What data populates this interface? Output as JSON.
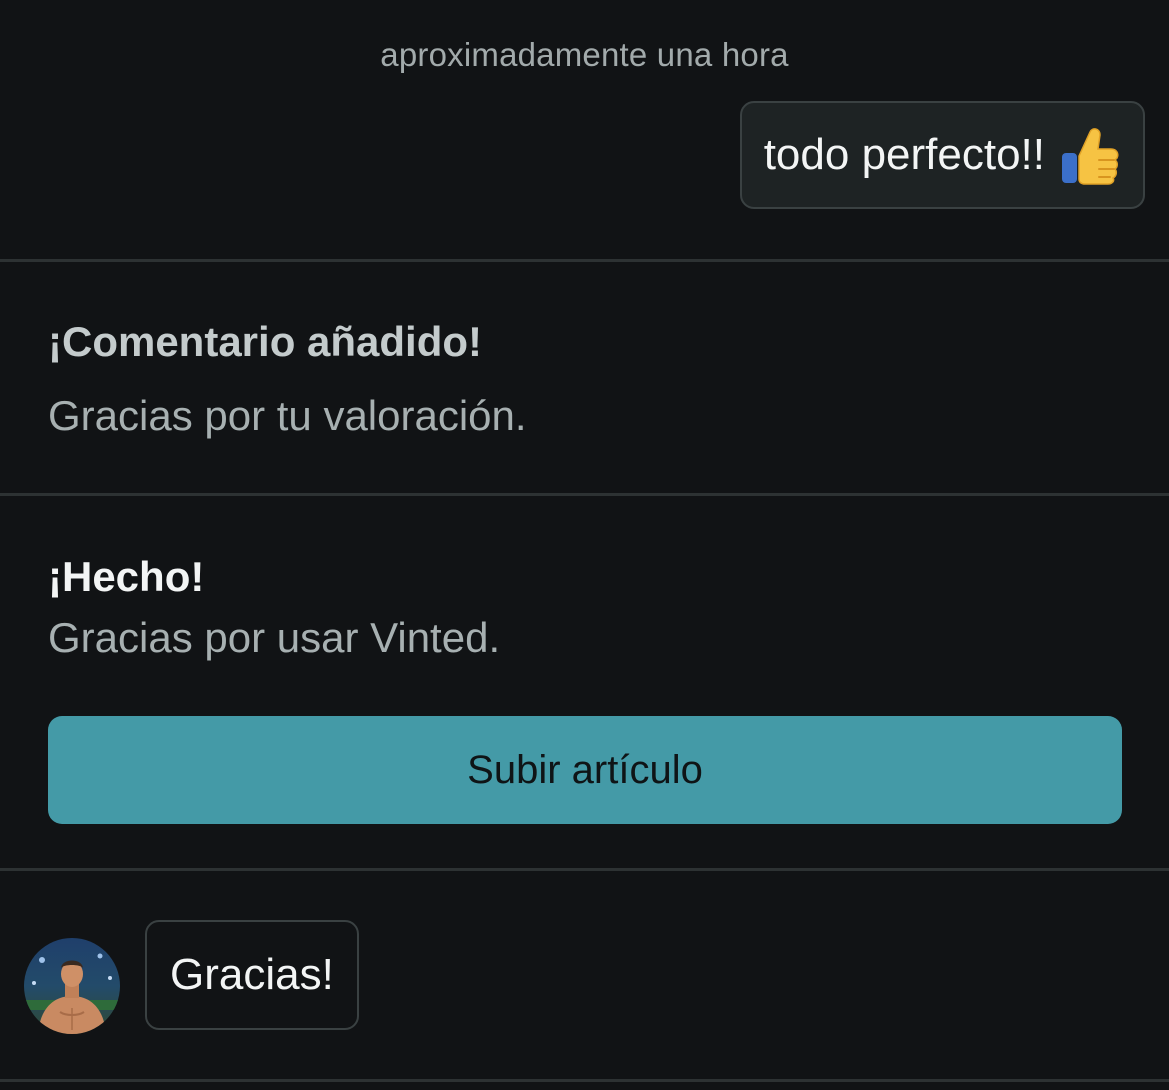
{
  "chat": {
    "timestamp": "aproximadamente una hora",
    "outgoing_message": "todo perfecto!!",
    "outgoing_emoji": "thumbs-up-icon",
    "incoming_message": "Gracias!"
  },
  "feedback_notice": {
    "title": "¡Comentario añadido!",
    "text": "Gracias por tu valoración."
  },
  "done_notice": {
    "title": "¡Hecho!",
    "text": "Gracias por usar Vinted."
  },
  "actions": {
    "upload_label": "Subir artículo"
  },
  "colors": {
    "background": "#111315",
    "accent": "#449aa7",
    "bubble_out": "#1e2324",
    "border": "#3a4142",
    "muted_text": "#a7b0b1"
  }
}
